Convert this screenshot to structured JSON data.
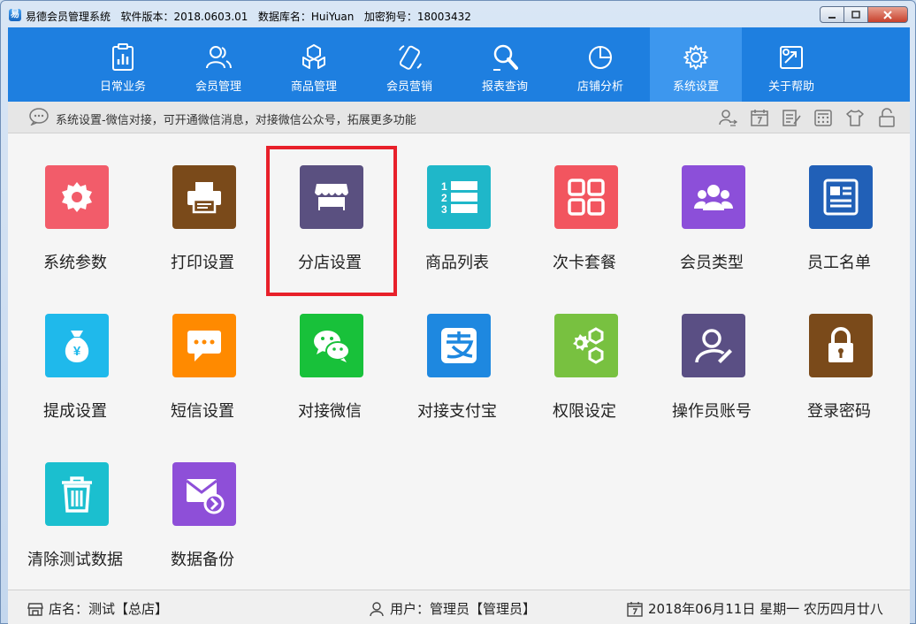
{
  "window": {
    "app_icon_letter": "易",
    "title": "易德会员管理系统",
    "version_label": "软件版本：2018.0603.01",
    "db_label": "数据库名：HuiYuan",
    "dongle_label": "加密狗号：18003432"
  },
  "nav": {
    "items": [
      {
        "label": "日常业务",
        "icon": "clipboard-chart-icon"
      },
      {
        "label": "会员管理",
        "icon": "users-icon"
      },
      {
        "label": "商品管理",
        "icon": "boxes-icon"
      },
      {
        "label": "会员营销",
        "icon": "phone-icon"
      },
      {
        "label": "报表查询",
        "icon": "search-report-icon"
      },
      {
        "label": "店铺分析",
        "icon": "pie-chart-icon"
      },
      {
        "label": "系统设置",
        "icon": "gear-icon"
      },
      {
        "label": "关于帮助",
        "icon": "help-icon"
      }
    ],
    "active_label": "系统设置"
  },
  "infobar": {
    "text": "系统设置-微信对接，可开通微信消息，对接微信公众号，拓展更多功能"
  },
  "tiles": [
    {
      "label": "系统参数",
      "color": "#f25c6a",
      "icon": "gear-icon"
    },
    {
      "label": "打印设置",
      "color": "#7a4a1a",
      "icon": "printer-icon"
    },
    {
      "label": "分店设置",
      "color": "#5a5080",
      "icon": "store-icon"
    },
    {
      "label": "商品列表",
      "color": "#1fb7c9",
      "icon": "numbered-list-icon"
    },
    {
      "label": "次卡套餐",
      "color": "#f2555f",
      "icon": "grid-icon"
    },
    {
      "label": "会员类型",
      "color": "#8c4fd9",
      "icon": "member-group-icon"
    },
    {
      "label": "员工名单",
      "color": "#2160b7",
      "icon": "id-card-icon"
    },
    {
      "label": "提成设置",
      "color": "#1fb9eb",
      "icon": "money-bag-icon"
    },
    {
      "label": "短信设置",
      "color": "#ff8a00",
      "icon": "sms-icon"
    },
    {
      "label": "对接微信",
      "color": "#18c13a",
      "icon": "wechat-icon"
    },
    {
      "label": "对接支付宝",
      "color": "#1e88e0",
      "icon": "alipay-icon"
    },
    {
      "label": "权限设定",
      "color": "#78c140",
      "icon": "gears-icon"
    },
    {
      "label": "操作员账号",
      "color": "#5a4f84",
      "icon": "operator-icon"
    },
    {
      "label": "登录密码",
      "color": "#7a4a1a",
      "icon": "lock-icon"
    },
    {
      "label": "清除测试数据",
      "color": "#1bbfcf",
      "icon": "trash-icon"
    },
    {
      "label": "数据备份",
      "color": "#8e4fd8",
      "icon": "mail-backup-icon"
    }
  ],
  "status": {
    "store": "店名：测试【总店】",
    "user": "用户：管理员【管理员】",
    "date": "2018年06月11日 星期一 农历四月廿八"
  }
}
